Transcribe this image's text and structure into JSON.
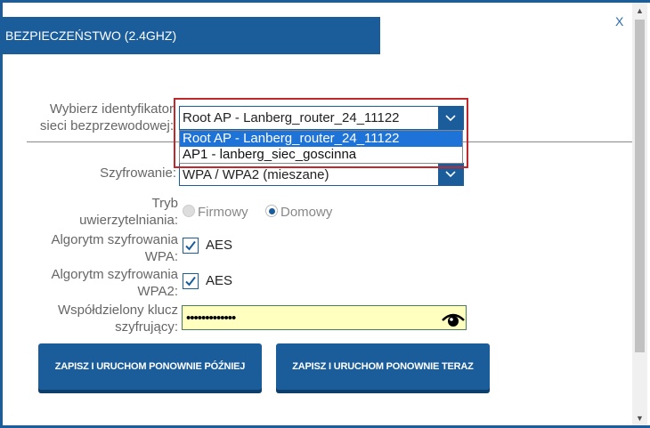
{
  "dialog": {
    "title": "BEZPIECZEŃSTWO (2.4GHZ)",
    "close_label": "X"
  },
  "ssid": {
    "label_line1": "Wybierz identyfikator",
    "label_line2": "sieci bezprzewodowej:",
    "selected": "Root AP - Lanberg_router_24_11122",
    "options": [
      "Root AP - Lanberg_router_24_11122",
      "AP1 - lanberg_siec_goscinna"
    ]
  },
  "encryption": {
    "label": "Szyfrowanie:",
    "value": "WPA / WPA2 (mieszane)"
  },
  "auth_mode": {
    "label_line1": "Tryb",
    "label_line2": "uwierzytelniania:",
    "option_company": "Firmowy",
    "option_home": "Domowy",
    "selected": "Domowy"
  },
  "wpa_algo": {
    "label_line1": "Algorytm szyfrowania",
    "label_line2": "WPA:",
    "value": "AES",
    "checked": true
  },
  "wpa2_algo": {
    "label_line1": "Algorytm szyfrowania",
    "label_line2": "WPA2:",
    "value": "AES",
    "checked": true
  },
  "shared_key": {
    "label_line1": "Współdzielony klucz",
    "label_line2": "szyfrujący:",
    "masked_value": "•••••••••••••"
  },
  "buttons": {
    "save_later": "ZAPISZ I URUCHOM PONOWNIE PÓŹNIEJ",
    "save_now": "ZAPISZ I URUCHOM PONOWNIE TERAZ"
  },
  "icons": {
    "close": "close-icon",
    "dropdown": "chevron-down-icon",
    "eye": "eye-icon",
    "checkbox": "check-icon"
  },
  "colors": {
    "brand": "#1b5d9b",
    "highlight": "#c0282c",
    "selected_option": "#1e73d8",
    "key_field": "#ffffc0"
  }
}
